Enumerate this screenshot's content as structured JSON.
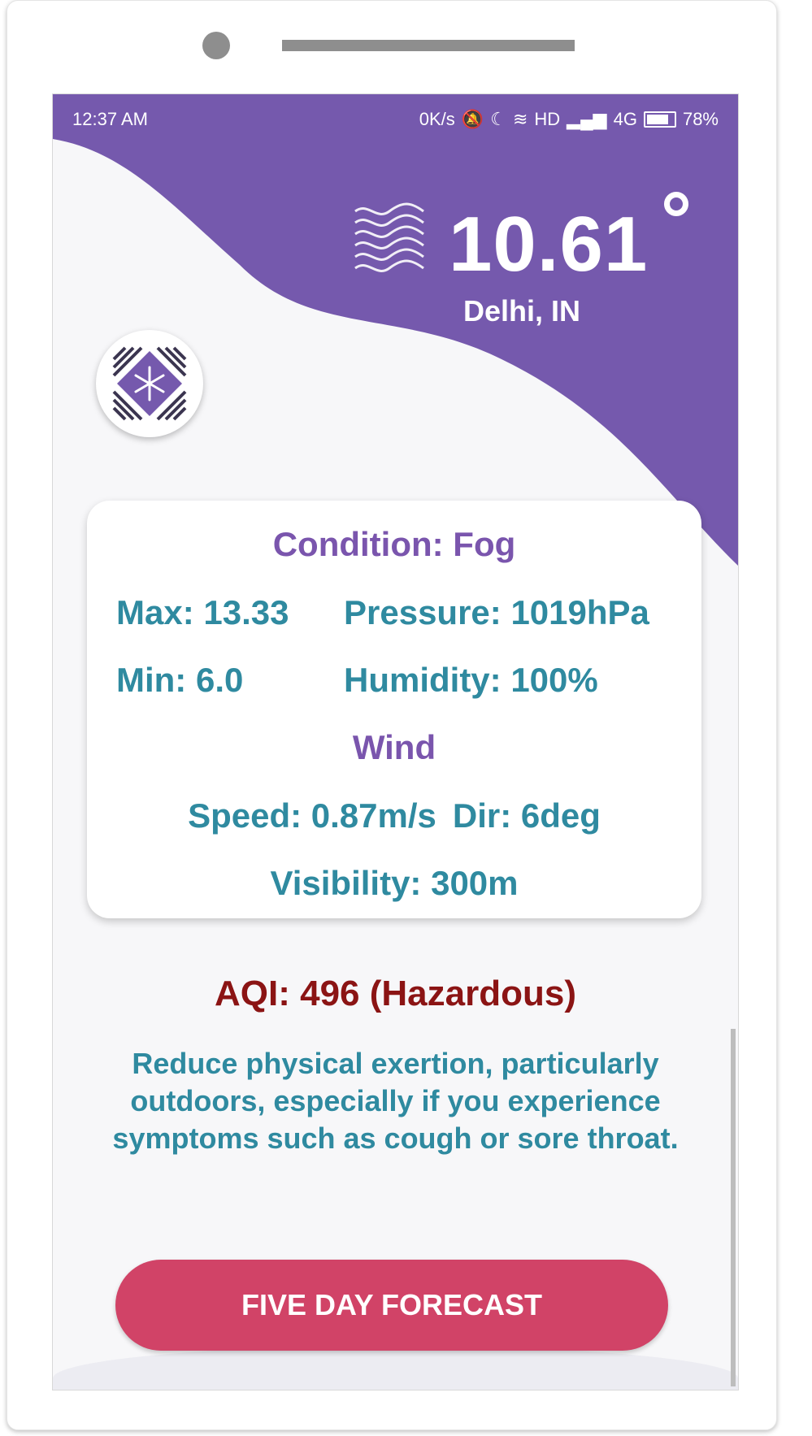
{
  "status_bar": {
    "time": "12:37 AM",
    "network_speed": "0K/s",
    "hd_label": "HD",
    "network_type": "4G",
    "battery": "78%"
  },
  "weather": {
    "temperature": "10.61",
    "location": "Delhi, IN",
    "condition_label": "Condition: Fog",
    "max": "Max: 13.33",
    "min": "Min: 6.0",
    "pressure": "Pressure: 1019hPa",
    "humidity": "Humidity: 100%",
    "wind_title": "Wind",
    "wind_speed": "Speed: 0.87m/s",
    "wind_dir": "Dir: 6deg",
    "visibility": "Visibility: 300m",
    "condition_icon": "fog-icon"
  },
  "aqi": {
    "label": "AQI: 496 (Hazardous)",
    "advice": "Reduce physical exertion, particularly outdoors, especially if you experience symptoms such as cough or sore throat."
  },
  "actions": {
    "forecast_button": "FIVE DAY FORECAST"
  },
  "colors": {
    "primary_purple": "#7559ad",
    "teal_text": "#2f8aa0",
    "aqi_red": "#8b1414",
    "button_pink": "#d14367"
  }
}
